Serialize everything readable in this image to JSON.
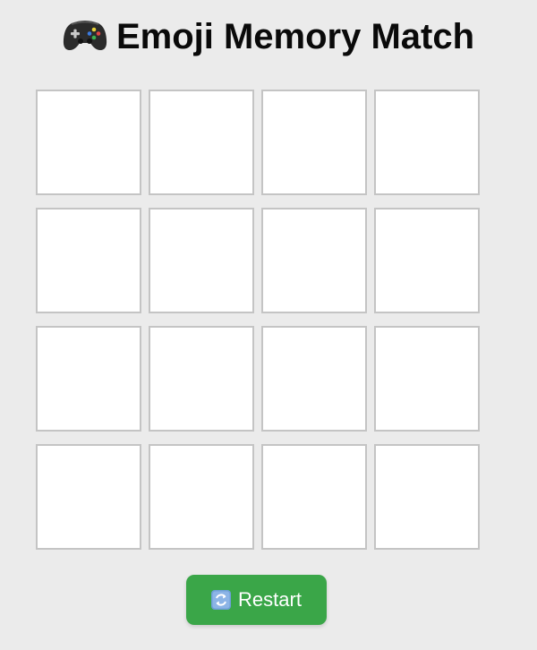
{
  "header": {
    "title": "Emoji Memory Match",
    "title_icon": "game-controller-icon"
  },
  "board": {
    "rows": 4,
    "columns": 4,
    "cards": [
      {
        "state": "face-down"
      },
      {
        "state": "face-down"
      },
      {
        "state": "face-down"
      },
      {
        "state": "face-down"
      },
      {
        "state": "face-down"
      },
      {
        "state": "face-down"
      },
      {
        "state": "face-down"
      },
      {
        "state": "face-down"
      },
      {
        "state": "face-down"
      },
      {
        "state": "face-down"
      },
      {
        "state": "face-down"
      },
      {
        "state": "face-down"
      },
      {
        "state": "face-down"
      },
      {
        "state": "face-down"
      },
      {
        "state": "face-down"
      },
      {
        "state": "face-down"
      }
    ]
  },
  "controls": {
    "restart_label": "Restart",
    "restart_icon": "refresh-icon"
  },
  "colors": {
    "background": "#ebebeb",
    "card_face": "#ffffff",
    "card_border": "#c4c4c4",
    "restart_button": "#3aa648"
  }
}
